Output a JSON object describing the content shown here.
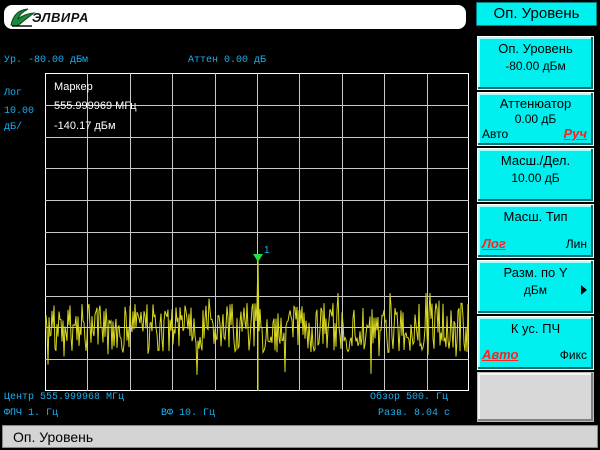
{
  "header": {
    "logo_text": "ЭЛВИРА",
    "menu_title": "Оп. Уровень"
  },
  "trace": {
    "ref_level": "Ур. -80.00 дБм",
    "attenuation": "Аттен 0.00 дБ",
    "scale_type": "Лог",
    "scale_value": "10.00",
    "scale_unit": "дБ/",
    "center": "Центр 555.999968 МГц",
    "span": "Обзор 500. Гц",
    "rbw": "ФПЧ 1. Гц",
    "vbw": "ВФ 10. Гц",
    "sweep": "Разв. 8.04 с"
  },
  "marker": {
    "title": "Маркер",
    "frequency": "555.999969 МГц",
    "amplitude": "-140.17 дБм",
    "number": "1"
  },
  "softkeys": [
    {
      "line1": "Оп. Уровень",
      "line2": "-80.00 дБм"
    },
    {
      "line1": "Аттенюатор",
      "line2": "0.00 дБ",
      "opt_left": "Авто",
      "opt_right": "Руч"
    },
    {
      "line1": "Масш./Дел.",
      "line2": "10.00 дБ"
    },
    {
      "line1": "Масш. Тип",
      "opt_left": "Лог",
      "opt_right": "Лин"
    },
    {
      "line1": "Разм. по Y",
      "line2": "дБм"
    },
    {
      "line1": "К ус. ПЧ",
      "opt_left": "Авто",
      "opt_right": "Фикс"
    }
  ],
  "status_bar": {
    "text": "Оп. Уровень"
  },
  "colors": {
    "trace": "#d8d820",
    "grid": "#ffffff",
    "annotation": "#1ab0f0",
    "softkey": "#00f0f0",
    "selected_option": "#ff2020",
    "marker": "#20e040"
  }
}
